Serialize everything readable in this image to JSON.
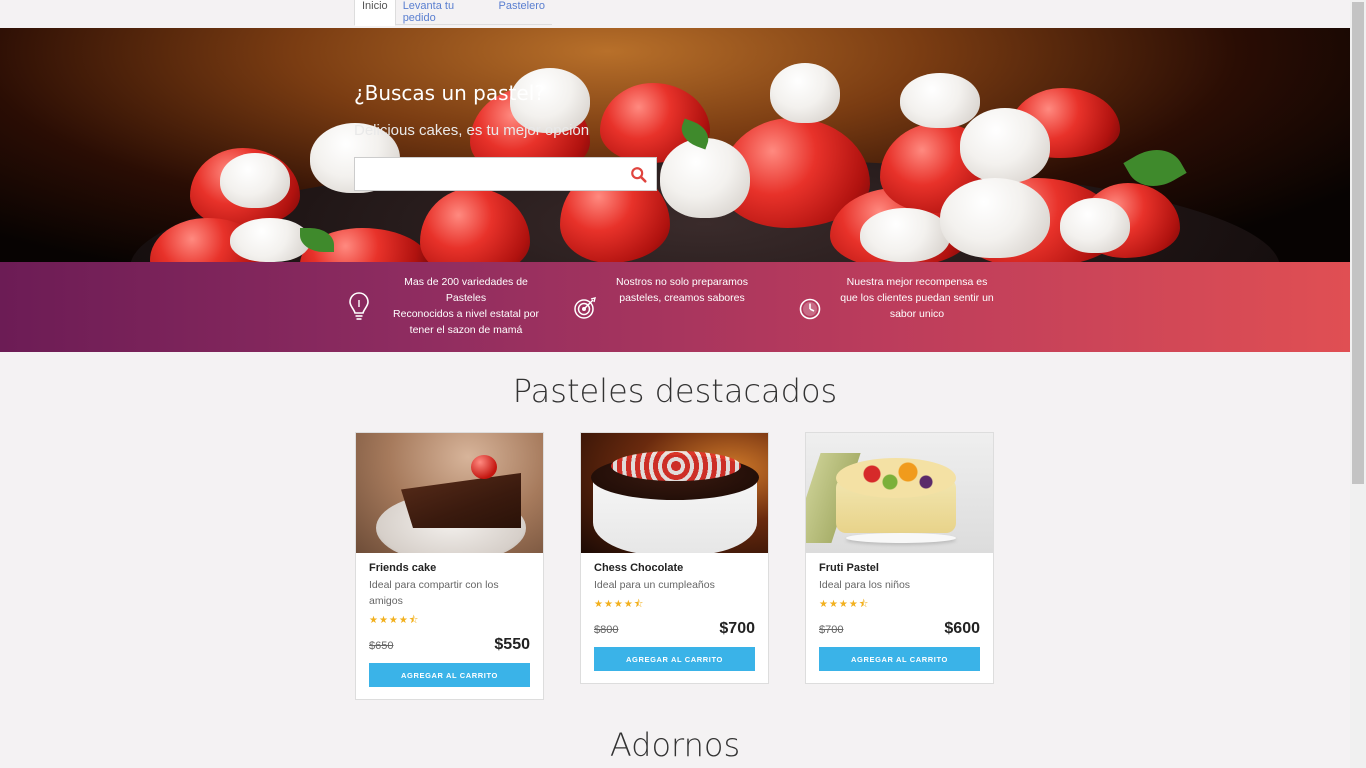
{
  "nav": {
    "tabs": [
      {
        "label": "Inicio",
        "active": true
      },
      {
        "label": "Levanta tu pedido",
        "active": false
      },
      {
        "label": "Pastelero",
        "active": false
      }
    ]
  },
  "hero": {
    "title": "¿Buscas un pastel?",
    "subtitle": "Delicious cakes, es tu mejor opcion",
    "search_placeholder": "",
    "search_icon": "search-icon"
  },
  "features": [
    {
      "icon": "lightbulb-icon",
      "lines": [
        "Mas de 200 variedades de",
        "Pasteles",
        "Reconocidos a nivel estatal por",
        "tener el sazon de mamá"
      ]
    },
    {
      "icon": "target-icon",
      "lines": [
        "Nostros no solo preparamos",
        "pasteles, creamos sabores"
      ]
    },
    {
      "icon": "clock-icon",
      "lines": [
        "Nuestra mejor recompensa es",
        "que los clientes puedan sentir un",
        "sabor unico"
      ]
    }
  ],
  "featured": {
    "title": "Pasteles destacados",
    "products": [
      {
        "name": "Friends cake",
        "description": "Ideal para compartir con los amigos",
        "rating": "★★★★⯪",
        "old_price": "$650",
        "price": "$550",
        "button": "AGREGAR AL CARRITO"
      },
      {
        "name": "Chess Chocolate",
        "description": "Ideal para un cumpleaños",
        "rating": "★★★★⯪",
        "old_price": "$800",
        "price": "$700",
        "button": "AGREGAR AL CARRITO"
      },
      {
        "name": "Fruti Pastel",
        "description": "Ideal para los niños",
        "rating": "★★★★⯪",
        "old_price": "$700",
        "price": "$600",
        "button": "AGREGAR AL CARRITO"
      }
    ]
  },
  "adornos": {
    "title": "Adornos"
  },
  "colors": {
    "accent": "#3ab3e8",
    "band_start": "#6c1c55",
    "band_end": "#e04f53",
    "star": "#f2b01e"
  }
}
